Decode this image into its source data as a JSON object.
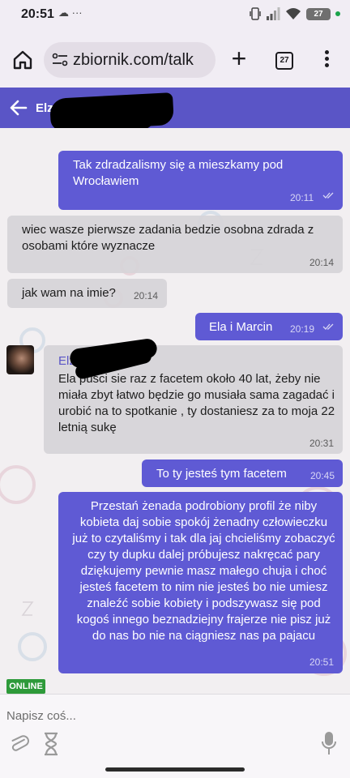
{
  "status_bar": {
    "time": "20:51",
    "left_icons": "☁ ···",
    "battery": "27"
  },
  "browser": {
    "url": "zbiornik.com/talk",
    "tab_count": "27"
  },
  "chat_header": {
    "contact_name": "Elz"
  },
  "messages": [
    {
      "direction": "out",
      "text": "Tak zdradzalismy się a mieszkamy pod Wrocławiem",
      "time": "20:11",
      "read": true
    },
    {
      "direction": "in",
      "text": "wiec wasze pierwsze zadania bedzie osobna zdrada z osobami które wyznacze",
      "time": "20:14"
    },
    {
      "direction": "in",
      "text": "jak wam na imie?",
      "time": "20:14"
    },
    {
      "direction": "out",
      "text": "Ela i Marcin",
      "time": "20:19",
      "read": true
    },
    {
      "direction": "in",
      "sender": "Elza",
      "text": "Ela puści sie raz z facetem około 40 lat, żeby nie miała zbyt łatwo będzie go musiała sama zagadać i urobić na to spotkanie , ty dostaniesz za to moja 22 letnią sukę",
      "time": "20:31"
    },
    {
      "direction": "out",
      "text": "To ty jesteś tym facetem",
      "time": "20:45"
    },
    {
      "direction": "out",
      "text": "Przestań żenada podrobiony profil że niby kobieta daj sobie spokój żenadny człowieczku już to czytaliśmy i tak dla jaj chcieliśmy zobaczyć czy ty dupku dalej próbujesz nakręcać pary dziękujemy pewnie masz małego chuja i choć jesteś facetem to nim nie jesteś bo nie umiesz znaleźć sobie kobiety i podszywasz się pod kogoś innego beznadziejny frajerze nie pisz już do nas bo nie na ciągniesz nas pa pajacu",
      "time": "20:51"
    }
  ],
  "status_badge": "ONLINE",
  "input": {
    "placeholder": "Napisz coś..."
  },
  "colors": {
    "accent": "#5a55c6",
    "outgoing_bubble": "#5f5ad4",
    "incoming_bubble": "#d6d4d8",
    "online": "#2e9a3a"
  }
}
